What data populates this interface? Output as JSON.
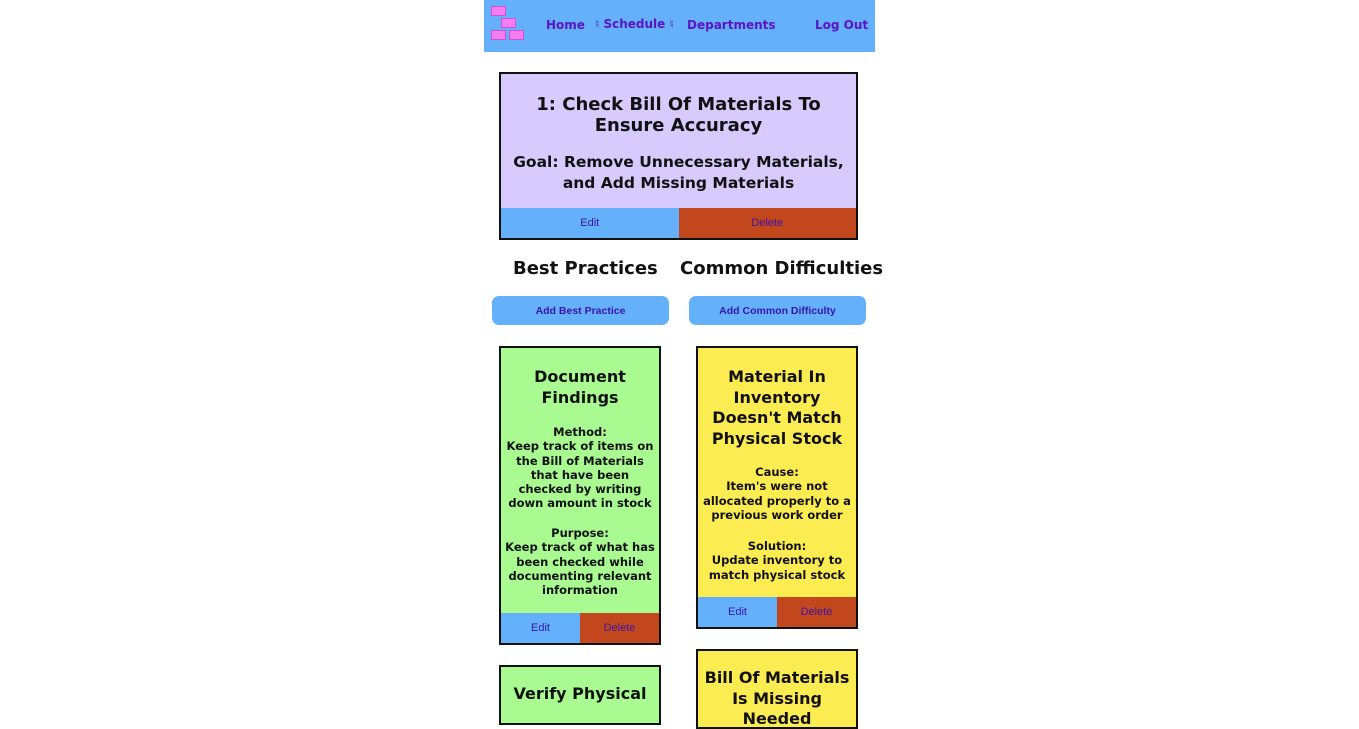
{
  "nav": {
    "home": "Home",
    "schedule": "♮ Schedule ♮",
    "departments": "Departments",
    "logout": "Log Out"
  },
  "step": {
    "title": "1: Check Bill Of Materials To Ensure Accuracy",
    "goal": "Goal: Remove Unnecessary Materials, and Add Missing Materials",
    "edit_label": "Edit",
    "delete_label": "Delete"
  },
  "best_practices": {
    "heading": "Best Practices",
    "add_label": "Add Best Practice",
    "items": [
      {
        "title": "Document Findings",
        "method_label": "Method:",
        "method": "Keep track of items on the Bill of Materials that have been checked by writing down amount in stock",
        "purpose_label": "Purpose:",
        "purpose": "Keep track of what has been checked while documenting relevant information",
        "edit_label": "Edit",
        "delete_label": "Delete"
      },
      {
        "title": "Verify Physical"
      }
    ]
  },
  "common_difficulties": {
    "heading": "Common Difficulties",
    "add_label": "Add Common Difficulty",
    "items": [
      {
        "title": "Material In Inventory Doesn't Match Physical Stock",
        "cause_label": "Cause:",
        "cause": "Item's were not allocated properly to a previous work order",
        "solution_label": "Solution:",
        "solution": "Update inventory to match physical stock",
        "edit_label": "Edit",
        "delete_label": "Delete"
      },
      {
        "title": "Bill Of Materials Is Missing Needed"
      }
    ]
  },
  "colors": {
    "nav_bg": "#64b0fb",
    "step_bg": "#d7cbfd",
    "best_practice_bg": "#a8fa91",
    "difficulty_bg": "#fbec52",
    "delete_bg": "#c3471d",
    "link_text": "#5a14c8"
  }
}
